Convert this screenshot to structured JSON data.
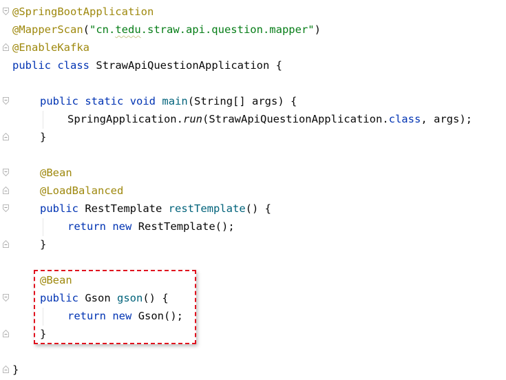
{
  "annotations": {
    "spring_boot": "@SpringBootApplication",
    "mapper_scan": "@MapperScan",
    "enable_kafka": "@EnableKafka",
    "bean": "@Bean",
    "load_balanced": "@LoadBalanced"
  },
  "punct": {
    "lparen": "(",
    "rparen": ")",
    "empty_call": "()",
    "space_lbrace": " {",
    "rbrace": "}",
    "semicolon": ";",
    "dot": ".",
    "comma_space": ", ",
    "empty_call_semicolon": "();",
    "close_semicolon": ");"
  },
  "strings": {
    "mapper_pkg_open": "\"cn.",
    "mapper_pkg_typo": "tedu",
    "mapper_pkg_rest": ".straw.api.question.mapper\""
  },
  "keywords": {
    "public": "public",
    "class": "class",
    "static": "static",
    "void": "void",
    "return": "return",
    "new": "new",
    "class_literal": "class"
  },
  "identifiers": {
    "class_name": "StrawApiQuestionApplication",
    "main": "main",
    "main_params": "String[] args",
    "spring_application": "SpringApplication",
    "run": "run",
    "args": "args",
    "rest_template_type": "RestTemplate",
    "rest_template_method": "restTemplate",
    "gson_type": "Gson",
    "gson_method": "gson"
  },
  "colors": {
    "annotation": "#9e880d",
    "keyword": "#0033b3",
    "string": "#067d17",
    "method": "#00627a",
    "highlight_border": "#e0121e"
  }
}
